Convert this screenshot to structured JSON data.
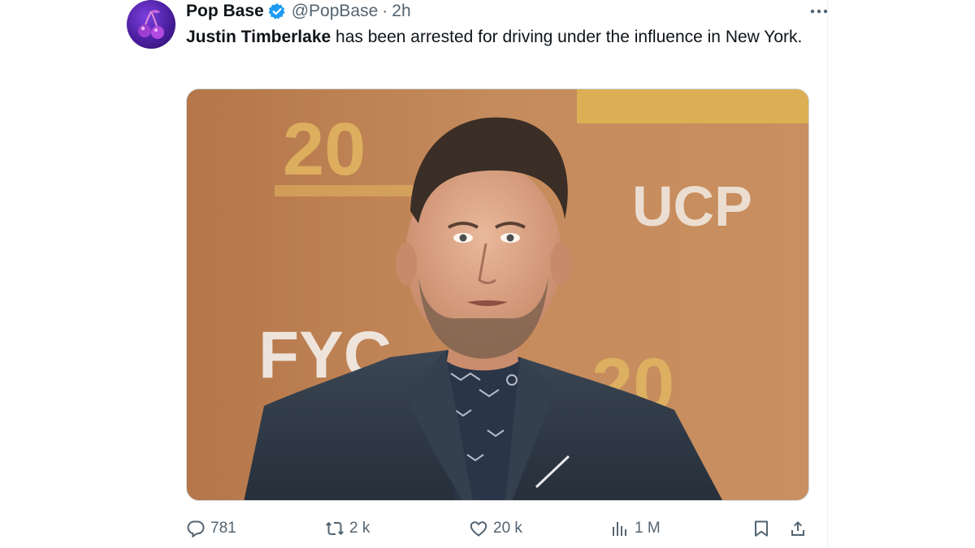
{
  "tweet": {
    "display_name": "Pop Base",
    "handle": "@PopBase",
    "separator": "·",
    "time": "2h",
    "text_bold": "Justin Timberlake",
    "text_rest": " has been arrested for driving under the influence in New York.",
    "photo_signs": {
      "sign_20": "20",
      "sign_fyc": "FYC",
      "sign_ucp": "UCP"
    }
  },
  "actions": {
    "replies": "781",
    "reposts": "2 k",
    "likes": "20 k",
    "views": "1 M"
  },
  "colors": {
    "verified": "#1d9bf0",
    "muted": "#536471",
    "text": "#0f1419"
  },
  "icons": [
    "avatar-cherry-icon",
    "verified-badge-icon",
    "more-icon",
    "reply-icon",
    "repost-icon",
    "like-icon",
    "views-icon",
    "bookmark-icon",
    "share-icon"
  ]
}
